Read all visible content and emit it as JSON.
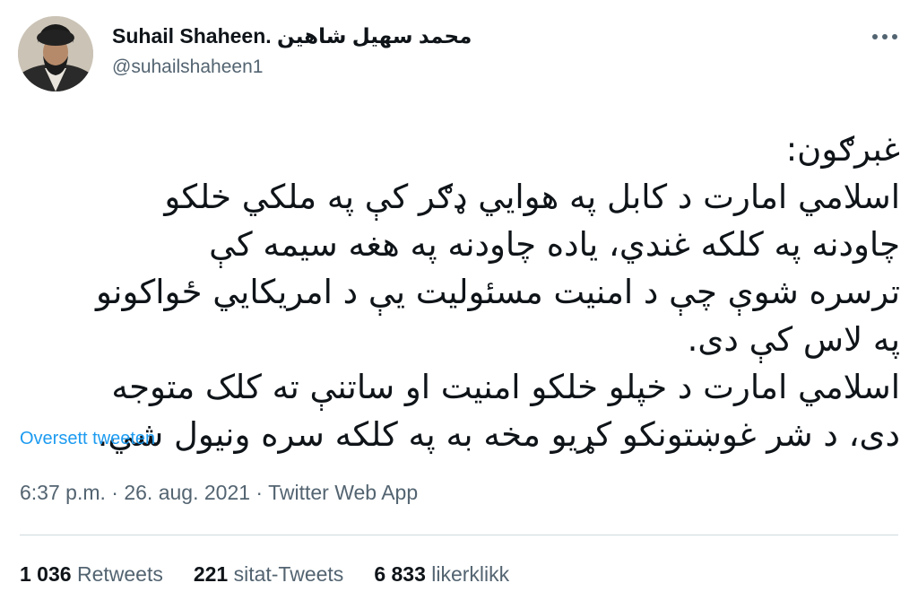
{
  "author": {
    "display_name": "Suhail Shaheen. محمد سهیل شاهين",
    "handle": "@suhailshaheen1"
  },
  "tweet": {
    "lines": [
      "غبرګون:",
      "اسلامي امارت د کابل په هوايي ډګر کې په ملکي خلکو",
      "چاودنه په کلکه غندي، ياده چاودنه په هغه سيمه کې",
      "ترسره شوې چې د امنيت مسئوليت يې د امريکايي ځواکونو",
      "په لاس کې دی.",
      "اسلامي امارت د خپلو خلکو امنيت او ساتنې ته کلک متوجه",
      "دی، د شر غوښتونکو کړيو مخه به په کلکه سره ونيول شي."
    ],
    "translate_label": "Oversett tweeten"
  },
  "meta": {
    "time": "6:37 p.m.",
    "sep1": "·",
    "date": "26. aug. 2021",
    "sep2": "·",
    "source": "Twitter Web App"
  },
  "stats": {
    "retweets": {
      "count": "1 036",
      "label": "Retweets"
    },
    "quotes": {
      "count": "221",
      "label": "sitat-Tweets"
    },
    "likes": {
      "count": "6 833",
      "label": "likerklikk"
    }
  },
  "icons": {
    "more": "more-horizontal-icon"
  },
  "colors": {
    "link": "#1d9bf0",
    "secondary_text": "#536471",
    "primary_text": "#0f1419",
    "divider": "#cfd9de"
  }
}
